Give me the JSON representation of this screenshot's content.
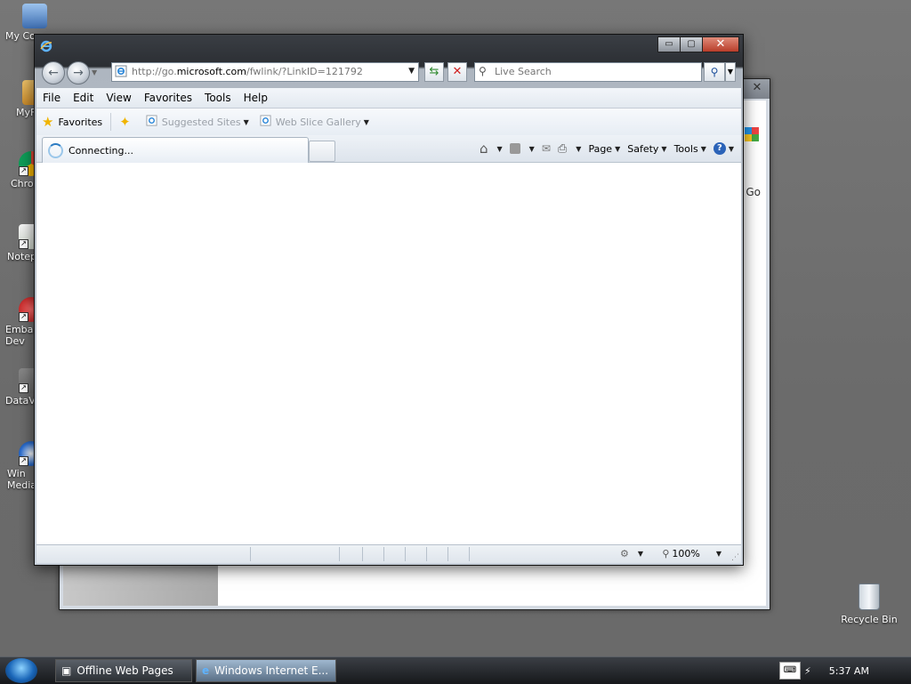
{
  "desktop": {
    "icons": [
      {
        "label": "My Co",
        "color": "#4a6fb5"
      },
      {
        "label": "MyF",
        "color": "#c98a2a"
      },
      {
        "label": "Chro",
        "color": "#4285f4"
      },
      {
        "label": "Notep",
        "color": "#6bb04b"
      },
      {
        "label": "Embar\nDev",
        "color": "#d02020"
      },
      {
        "label": "DataV",
        "color": "#b03030"
      },
      {
        "label": "Win\nMedia",
        "color": "#2d6fd0"
      }
    ],
    "recycle_bin": "Recycle Bin"
  },
  "back_window": {
    "go_label": "Go"
  },
  "ie": {
    "caption": {
      "minimize": "▭",
      "maximize": "▢",
      "close": "✕"
    },
    "address": {
      "url_prefix": "http://go.",
      "url_domain": "microsoft.com",
      "url_suffix": "/fwlink/?LinkID=121792"
    },
    "search": {
      "placeholder": "Live Search"
    },
    "menu": [
      "File",
      "Edit",
      "View",
      "Favorites",
      "Tools",
      "Help"
    ],
    "favorites_bar": {
      "favorites": "Favorites",
      "suggested_sites": "Suggested Sites",
      "web_slice_gallery": "Web Slice Gallery"
    },
    "tab": {
      "title": "Connecting..."
    },
    "commands": {
      "page": "Page",
      "safety": "Safety",
      "tools": "Tools"
    },
    "status": {
      "zoom": "100%"
    }
  },
  "taskbar": {
    "buttons": [
      {
        "label": "Offline Web Pages"
      },
      {
        "label": "Windows Internet E..."
      }
    ],
    "clock": "5:37 AM"
  },
  "colors": {
    "accent": "#1a66b8",
    "close_red": "#b83d2a"
  }
}
